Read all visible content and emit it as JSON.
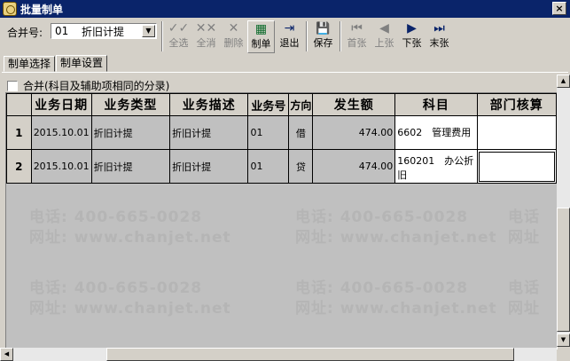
{
  "window": {
    "title": "批量制单",
    "close": "×"
  },
  "toolbar": {
    "merge_label": "合并号:",
    "merge_code": "01",
    "merge_name": "折旧计提",
    "buttons": [
      {
        "label": "全选",
        "icon": "✓✓",
        "enabled": false
      },
      {
        "label": "全消",
        "icon": "✕✕",
        "enabled": false
      },
      {
        "label": "删除",
        "icon": "✕",
        "enabled": false
      },
      {
        "label": "制单",
        "icon": "▦",
        "enabled": true
      },
      {
        "label": "退出",
        "icon": "⇥",
        "enabled": true
      },
      {
        "label": "保存",
        "icon": "💾",
        "enabled": true
      },
      {
        "label": "首张",
        "icon": "⏮",
        "enabled": false
      },
      {
        "label": "上张",
        "icon": "◀",
        "enabled": false
      },
      {
        "label": "下张",
        "icon": "▶",
        "enabled": true
      },
      {
        "label": "末张",
        "icon": "⏭",
        "enabled": true
      }
    ]
  },
  "tabs": [
    {
      "label": "制单选择",
      "active": false
    },
    {
      "label": "制单设置",
      "active": true
    }
  ],
  "merge_option": {
    "label": "合并(科目及辅助项相同的分录)",
    "checked": false
  },
  "grid": {
    "columns": [
      "业务日期",
      "业务类型",
      "业务描述",
      "业务号",
      "方向",
      "发生额",
      "科目",
      "部门核算"
    ],
    "rows": [
      {
        "index": "1",
        "date": "2015.10.01",
        "type": "折旧计提",
        "desc": "折旧计提",
        "no": "01",
        "dir": "借",
        "amount": "474.00",
        "subject": "6602　管理费用"
      },
      {
        "index": "2",
        "date": "2015.10.01",
        "type": "折旧计提",
        "desc": "折旧计提",
        "no": "01",
        "dir": "贷",
        "amount": "474.00",
        "subject": "160201　办公折旧"
      }
    ]
  },
  "watermark": {
    "phone": "电话: 400-665-0028",
    "site": "网址: www.chanjet.net"
  }
}
